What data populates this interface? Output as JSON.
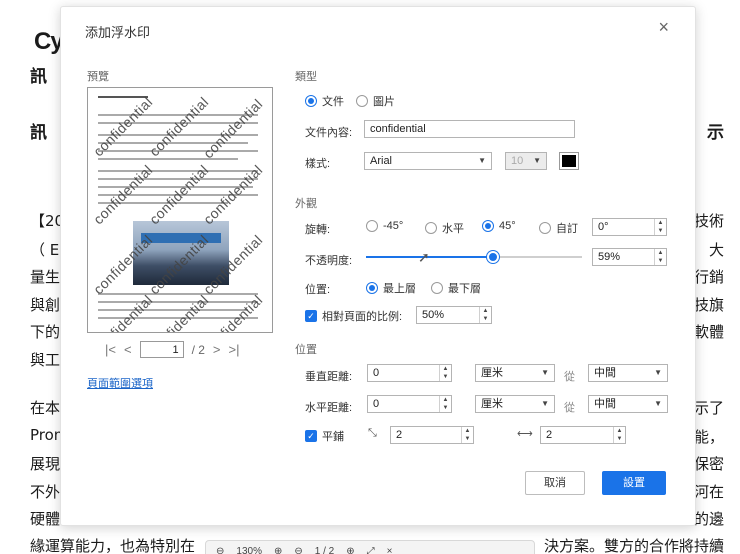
{
  "background_doc": {
    "brand": "Cy",
    "lines_left": [
      "訊",
      "訊",
      "【20",
      "（ Ed",
      "量生",
      "與創",
      "下的",
      "與工",
      "在本",
      "Prom",
      "展現",
      "不外",
      "硬體"
    ],
    "lines_right": [
      "示",
      "技術",
      "大",
      "行銷",
      "技旗",
      "軟體",
      "示了",
      "能，",
      "保密",
      "河在",
      "的邊"
    ],
    "bottom_line": "緣運算能力，也為特別在",
    "bottom_line_right": "決方案。雙方的合作將持續"
  },
  "viewer_toolbar": {
    "zoom": "130%",
    "page": "1 / 2"
  },
  "dialog": {
    "title": "添加浮水印",
    "close_glyph": "×",
    "preview_label": "預覽",
    "preview_watermark_text": "confidential",
    "pager": {
      "first": "|<",
      "prev": "<",
      "current": "1",
      "total": "/ 2",
      "next": ">",
      "last": ">|"
    },
    "page_range_link": "頁面範圍選項",
    "type_section": {
      "title": "類型",
      "options": [
        "文件",
        "圖片"
      ],
      "selected": "文件",
      "text_label": "文件內容:",
      "text_value": "confidential",
      "style_label": "樣式:",
      "font": "Arial",
      "size": "10",
      "color": "#000000"
    },
    "appearance_section": {
      "title": "外觀",
      "rotation_label": "旋轉:",
      "rotation_options": [
        "-45°",
        "水平",
        "45°",
        "自訂"
      ],
      "rotation_selected": "45°",
      "custom_angle": "0°",
      "opacity_label": "不透明度:",
      "opacity_percent": 59,
      "opacity_text": "59%",
      "position_label": "位置:",
      "position_options": [
        "最上層",
        "最下層"
      ],
      "position_selected": "最上層",
      "relative_scale_label": "相對頁面的比例:",
      "relative_scale_checked": true,
      "relative_scale_value": "50%"
    },
    "position_section": {
      "title": "位置",
      "vertical_label": "垂直距離:",
      "vertical_value": "0",
      "vertical_unit": "厘米",
      "vertical_from_label": "從",
      "vertical_from": "中間",
      "horizontal_label": "水平距離:",
      "horizontal_value": "0",
      "horizontal_unit": "厘米",
      "horizontal_from_label": "從",
      "horizontal_from": "中間",
      "tile_label": "平鋪",
      "tile_checked": true,
      "tile_vertical_value": "2",
      "tile_horizontal_value": "2"
    },
    "buttons": {
      "cancel": "取消",
      "ok": "設置"
    },
    "accent_color": "#1a73e8"
  }
}
